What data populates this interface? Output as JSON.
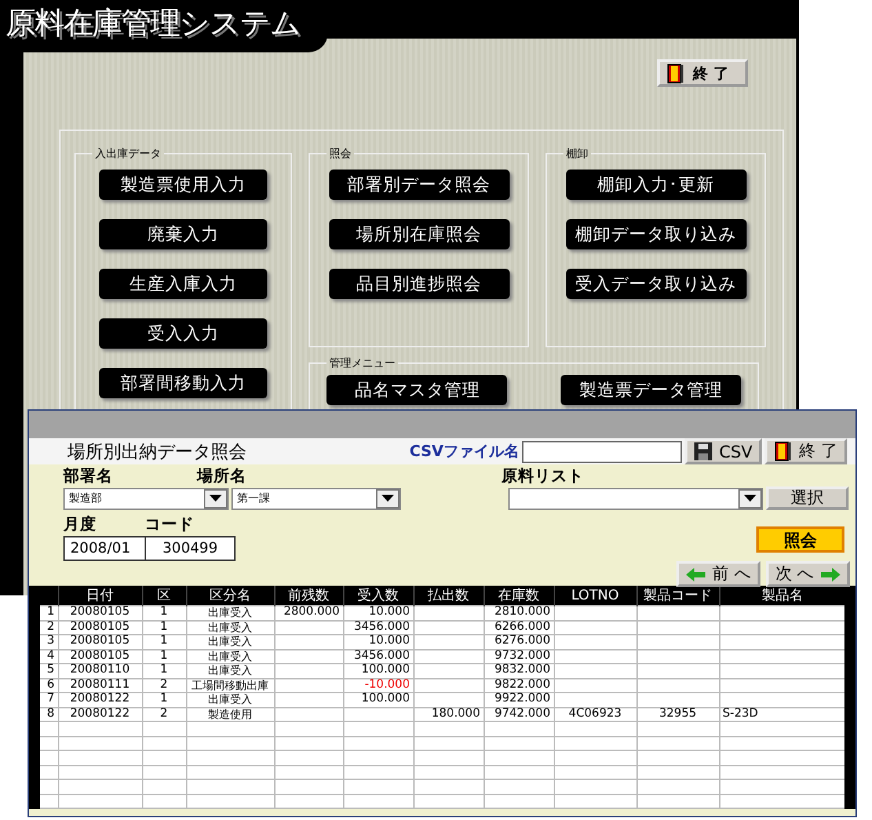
{
  "menu_window": {
    "title": "原料在庫管理システム",
    "exit_button": "終 了",
    "groups": [
      {
        "label": "入出庫データ",
        "buttons": [
          "製造票使用入力",
          "廃棄入力",
          "生産入庫入力",
          "受入入力",
          "部署間移動入力"
        ]
      },
      {
        "label": "照会",
        "buttons": [
          "部署別データ照会",
          "場所別在庫照会",
          "品目別進捗照会"
        ]
      },
      {
        "label": "棚卸",
        "buttons": [
          "棚卸入力･更新",
          "棚卸データ取り込み",
          "受入データ取り込み"
        ]
      },
      {
        "label": "管理メニュー",
        "buttons": [
          "品名マスタ管理",
          "製造票データ管理"
        ]
      }
    ]
  },
  "query_window": {
    "title": "場所別出納データ照会",
    "csv_label": "CSVファイル名",
    "csv_button": "CSV",
    "exit_button": "終 了",
    "department": {
      "label": "部署名",
      "value": "製造部"
    },
    "place": {
      "label": "場所名",
      "value": "第一課"
    },
    "material_list": {
      "label": "原料リスト"
    },
    "select_button": "選択",
    "month": {
      "label": "月度",
      "value": "2008/01"
    },
    "code": {
      "label": "コード",
      "value": "300499"
    },
    "query_button": "照会",
    "prev_button": "前 へ",
    "next_button": "次 へ",
    "table": {
      "columns": [
        "日付",
        "区",
        "区分名",
        "前残数",
        "受入数",
        "払出数",
        "在庫数",
        "LOTNO",
        "製品コード",
        "製品名"
      ],
      "rows": [
        {
          "number": "1",
          "cells": [
            "20080105",
            "1",
            "出庫受入",
            "2800.000",
            "10.000",
            "",
            "2810.000",
            "",
            "",
            ""
          ],
          "negative_receipt": false
        },
        {
          "number": "2",
          "cells": [
            "20080105",
            "1",
            "出庫受入",
            "",
            "3456.000",
            "",
            "6266.000",
            "",
            "",
            ""
          ],
          "negative_receipt": false
        },
        {
          "number": "3",
          "cells": [
            "20080105",
            "1",
            "出庫受入",
            "",
            "10.000",
            "",
            "6276.000",
            "",
            "",
            ""
          ],
          "negative_receipt": false
        },
        {
          "number": "4",
          "cells": [
            "20080105",
            "1",
            "出庫受入",
            "",
            "3456.000",
            "",
            "9732.000",
            "",
            "",
            ""
          ],
          "negative_receipt": false
        },
        {
          "number": "5",
          "cells": [
            "20080110",
            "1",
            "出庫受入",
            "",
            "100.000",
            "",
            "9832.000",
            "",
            "",
            ""
          ],
          "negative_receipt": false
        },
        {
          "number": "6",
          "cells": [
            "20080111",
            "2",
            "工場間移動出庫",
            "",
            "-10.000",
            "",
            "9822.000",
            "",
            "",
            ""
          ],
          "negative_receipt": true
        },
        {
          "number": "7",
          "cells": [
            "20080122",
            "1",
            "出庫受入",
            "",
            "100.000",
            "",
            "9922.000",
            "",
            "",
            ""
          ],
          "negative_receipt": false
        },
        {
          "number": "8",
          "cells": [
            "20080122",
            "2",
            "製造使用",
            "",
            "",
            "180.000",
            "9742.000",
            "4C06923",
            "32955",
            "S-23D"
          ]
        }
      ]
    }
  }
}
